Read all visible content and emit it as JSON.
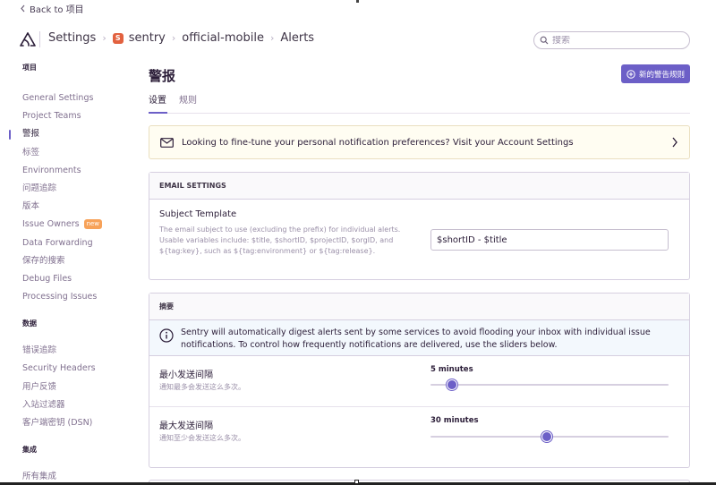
{
  "back_link": "Back to 项目",
  "header": {
    "breadcrumbs": [
      "Settings",
      "sentry",
      "official-mobile",
      "Alerts"
    ],
    "project_badge": "S",
    "search_placeholder": "搜索"
  },
  "sidebar": {
    "sections": [
      {
        "title": "项目",
        "items": [
          {
            "label": "General Settings"
          },
          {
            "label": "Project Teams"
          },
          {
            "label": "警报",
            "active": true
          },
          {
            "label": "标签"
          },
          {
            "label": "Environments"
          },
          {
            "label": "问题追踪"
          },
          {
            "label": "版本"
          },
          {
            "label": "Issue Owners",
            "badge": "new"
          },
          {
            "label": "Data Forwarding"
          },
          {
            "label": "保存的搜索"
          },
          {
            "label": "Debug Files"
          },
          {
            "label": "Processing Issues"
          }
        ]
      },
      {
        "title": "数据",
        "items": [
          {
            "label": "错误追踪"
          },
          {
            "label": "Security Headers"
          },
          {
            "label": "用户反馈"
          },
          {
            "label": "入站过滤器"
          },
          {
            "label": "客户端密钥 (DSN)"
          }
        ]
      },
      {
        "title": "集成",
        "items": [
          {
            "label": "所有集成"
          }
        ]
      }
    ]
  },
  "main": {
    "title": "警报",
    "new_rule_button": "新的警告规则",
    "tabs": [
      {
        "label": "设置",
        "active": true
      },
      {
        "label": "规则"
      }
    ],
    "notice": "Looking to fine-tune your personal notification preferences? Visit your Account Settings",
    "email_settings": {
      "header": "EMAIL SETTINGS",
      "subject_label": "Subject Template",
      "subject_help": "The email subject to use (excluding the prefix) for individual alerts. Usable variables include: $title, $shortID, $projectID, $orgID, and ${tag:key}, such as ${tag:environment} or ${tag:release}.",
      "subject_value": "$shortID - $title"
    },
    "digest": {
      "header": "摘要",
      "info": "Sentry will automatically digest alerts sent by some services to avoid flooding your inbox with individual issue notifications. To control how frequently notifications are delivered, use the sliders below.",
      "sliders": [
        {
          "label": "最小发送间隔",
          "help": "通知最多会发送这么多次。",
          "value_text": "5 minutes",
          "level": 0.09
        },
        {
          "label": "最大发送间隔",
          "help": "通知至少会发送这么多次。",
          "value_text": "30 minutes",
          "level": 0.49
        }
      ]
    }
  },
  "colors": {
    "accent": "#6c5fc7",
    "project_badge": "#e2613f",
    "new_badge": "#f7a259"
  }
}
